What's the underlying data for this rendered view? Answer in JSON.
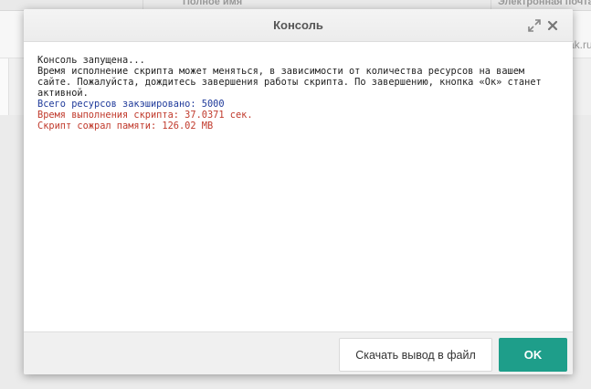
{
  "background": {
    "header_cols": [
      "Полное имя",
      "Электронная почта"
    ],
    "row_cells": [
      "ak.ru"
    ]
  },
  "modal": {
    "title": "Консоль",
    "lines": [
      {
        "text": "Консоль запущена...",
        "kind": "normal"
      },
      {
        "text": "Время исполнение скрипта может меняться, в зависимости от количества ресурсов на вашем сайте. Пожалуйста, дождитесь завершения работы скрипта. По завершению, кнопка «Ок» станет активной.",
        "kind": "normal"
      },
      {
        "text": "Всего ресурсов закэшировано: 5000",
        "kind": "info"
      },
      {
        "text": "Время выполнения скрипта: 37.0371 сек.",
        "kind": "red"
      },
      {
        "text": "Скрипт сожрал памяти: 126.02 MB",
        "kind": "red"
      }
    ],
    "download_label": "Скачать вывод в файл",
    "ok_label": "OK"
  },
  "icons": {
    "expand": "expand-icon",
    "close": "close-icon"
  },
  "colors": {
    "accent": "#1e9e8a",
    "info_text": "#1f3a9a",
    "warning_text": "#c0392b"
  }
}
